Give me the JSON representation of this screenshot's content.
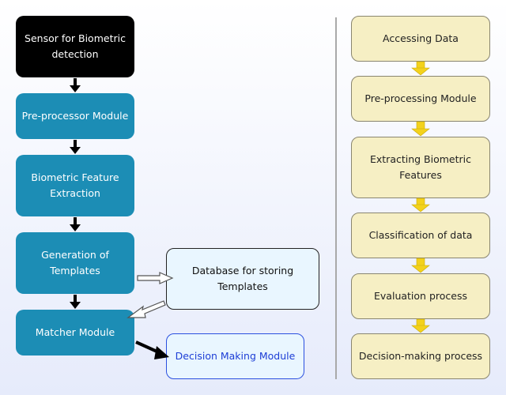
{
  "left_flow": {
    "sensor": "Sensor for Biometric detection",
    "preprocessor": "Pre-processor Module",
    "feature_extraction": "Biometric Feature Extraction",
    "template_generation": "Generation of Templates",
    "matcher": "Matcher Module",
    "database": "Database for storing Templates",
    "decision": "Decision Making Module"
  },
  "right_flow": {
    "steps": [
      "Accessing Data",
      "Pre-processing Module",
      "Extracting Biometric Features",
      "Classification of data",
      "Evaluation process",
      "Decision-making process"
    ]
  },
  "colors": {
    "sensor_fill": "#000000",
    "module_fill": "#1c8db5",
    "database_fill": "#e9f6ff",
    "decision_text": "#1d3ed6",
    "step_fill": "#f6efc4",
    "step_arrow": "#f3d21c"
  }
}
